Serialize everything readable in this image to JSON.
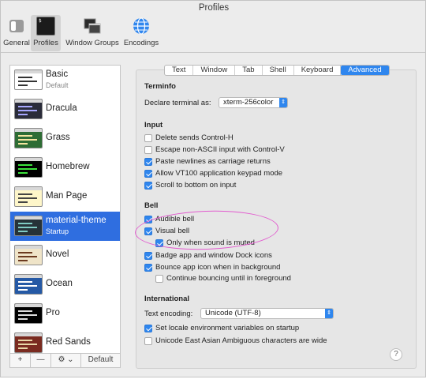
{
  "window": {
    "title": "Profiles"
  },
  "toolbar": {
    "items": [
      {
        "label": "General",
        "icon": "general-switch-icon"
      },
      {
        "label": "Profiles",
        "icon": "terminal-icon"
      },
      {
        "label": "Window Groups",
        "icon": "window-groups-icon"
      },
      {
        "label": "Encodings",
        "icon": "globe-icon"
      }
    ]
  },
  "profiles": [
    {
      "name": "Basic",
      "sub": "Default",
      "bg": "#ffffff",
      "fg": "#333333"
    },
    {
      "name": "Dracula",
      "sub": "",
      "bg": "#2a2c3a",
      "fg": "#a8a8ff"
    },
    {
      "name": "Grass",
      "sub": "",
      "bg": "#2e6d35",
      "fg": "#f5e6a0"
    },
    {
      "name": "Homebrew",
      "sub": "",
      "bg": "#000000",
      "fg": "#3be13b"
    },
    {
      "name": "Man Page",
      "sub": "",
      "bg": "#fef6c9",
      "fg": "#444444"
    },
    {
      "name": "material-theme",
      "sub": "Startup",
      "bg": "#263238",
      "fg": "#80cbc4"
    },
    {
      "name": "Novel",
      "sub": "",
      "bg": "#efe4c8",
      "fg": "#6b3a1f"
    },
    {
      "name": "Ocean",
      "sub": "",
      "bg": "#2559a5",
      "fg": "#ffffff"
    },
    {
      "name": "Pro",
      "sub": "",
      "bg": "#000000",
      "fg": "#dddddd"
    },
    {
      "name": "Red Sands",
      "sub": "",
      "bg": "#7a2b20",
      "fg": "#e8d6a8"
    }
  ],
  "sidebar_footer": {
    "add": "+",
    "remove": "—",
    "gear": "⚙ ⌄",
    "default": "Default"
  },
  "tabs": [
    "Text",
    "Window",
    "Tab",
    "Shell",
    "Keyboard",
    "Advanced"
  ],
  "terminfo": {
    "title": "Terminfo",
    "declare_label": "Declare terminal as:",
    "declare_value": "xterm-256color"
  },
  "input": {
    "title": "Input",
    "options": [
      {
        "label": "Delete sends Control-H",
        "checked": false
      },
      {
        "label": "Escape non-ASCII input with Control-V",
        "checked": false
      },
      {
        "label": "Paste newlines as carriage returns",
        "checked": true
      },
      {
        "label": "Allow VT100 application keypad mode",
        "checked": true
      },
      {
        "label": "Scroll to bottom on input",
        "checked": true
      }
    ]
  },
  "bell": {
    "title": "Bell",
    "audible": "Audible bell",
    "visual": "Visual bell",
    "only_muted": "Only when sound is muted",
    "badge": "Badge app and window Dock icons",
    "bounce": "Bounce app icon when in background",
    "continue": "Continue bouncing until in foreground"
  },
  "international": {
    "title": "International",
    "encoding_label": "Text encoding:",
    "encoding_value": "Unicode (UTF-8)",
    "locale": "Set locale environment variables on startup",
    "east_asian": "Unicode East Asian Ambiguous characters are wide"
  },
  "help": "?",
  "colors": {
    "accent": "#2f86ee",
    "selection": "#2f6ee0",
    "annotation": "#e25ccf"
  }
}
